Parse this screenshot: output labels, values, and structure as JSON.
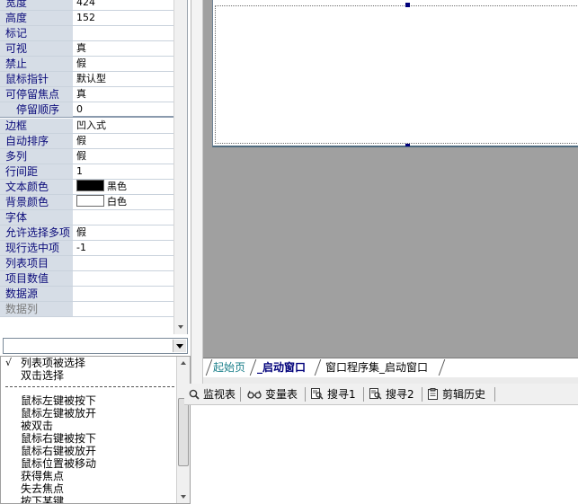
{
  "properties": [
    {
      "name": "宽度",
      "value": "424"
    },
    {
      "name": "高度",
      "value": "152"
    },
    {
      "name": "标记",
      "value": ""
    },
    {
      "name": "可视",
      "value": "真"
    },
    {
      "name": "禁止",
      "value": "假"
    },
    {
      "name": "鼠标指针",
      "value": "默认型"
    },
    {
      "name": "可停留焦点",
      "value": "真"
    },
    {
      "name": "停留顺序",
      "value": "0"
    },
    {
      "name": "边框",
      "value": "凹入式"
    },
    {
      "name": "自动排序",
      "value": "假"
    },
    {
      "name": "多列",
      "value": "假"
    },
    {
      "name": "行间距",
      "value": "1"
    },
    {
      "name": "文本颜色",
      "value": "黑色",
      "swatch": "#000000"
    },
    {
      "name": "背景颜色",
      "value": "白色",
      "swatch": "#ffffff"
    },
    {
      "name": "字体",
      "value": ""
    },
    {
      "name": "允许选择多项",
      "value": "假"
    },
    {
      "name": "现行选中项",
      "value": "-1"
    },
    {
      "name": "列表项目",
      "value": ""
    },
    {
      "name": "项目数值",
      "value": ""
    },
    {
      "name": "数据源",
      "value": ""
    },
    {
      "name": "数据列",
      "value": ""
    }
  ],
  "event_combo": {
    "value": ""
  },
  "events": {
    "check_mark": "√",
    "items": [
      "列表项被选择",
      "双击选择",
      "鼠标左键被按下",
      "鼠标左键被放开",
      "被双击",
      "鼠标右键被按下",
      "鼠标右键被放开",
      "鼠标位置被移动",
      "获得焦点",
      "失去焦点",
      "按下某键"
    ]
  },
  "tabs": [
    "起始页",
    "_启动窗口",
    "窗口程序集_启动窗口"
  ],
  "toolbar": {
    "items": [
      {
        "label": "监视表",
        "icon": "magnifier-icon"
      },
      {
        "label": "变量表",
        "icon": "glasses-icon"
      },
      {
        "label": "搜寻1",
        "icon": "find-list-icon"
      },
      {
        "label": "搜寻2",
        "icon": "find-list-icon"
      },
      {
        "label": "剪辑历史",
        "icon": "clipboard-icon"
      }
    ]
  },
  "colors": {
    "grid_name_bg": "#d6dde6",
    "designer_bg": "#a0a0a0",
    "tab_active": "#00007a",
    "tab_link": "#1a7f8a"
  }
}
